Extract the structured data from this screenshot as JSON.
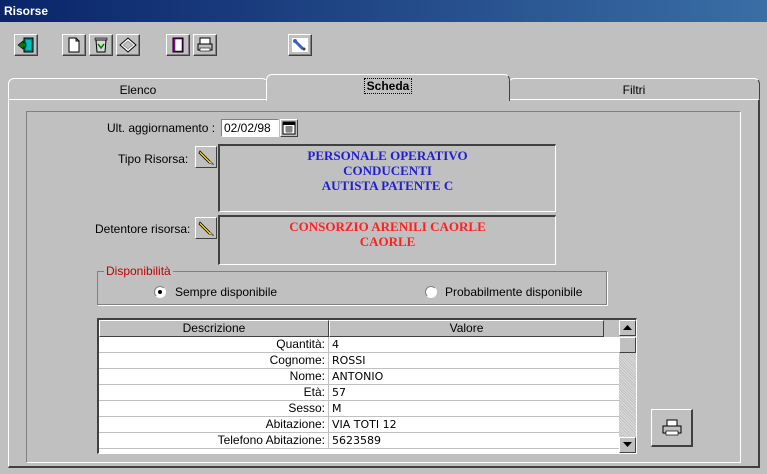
{
  "window": {
    "title": "Risorse"
  },
  "toolbar": {
    "buttons": [
      {
        "icon": "exit-door-icon"
      },
      {
        "icon": "new-document-icon"
      },
      {
        "icon": "recycle-bin-icon"
      },
      {
        "icon": "eraser-icon"
      },
      {
        "icon": "book-icon"
      },
      {
        "icon": "printer-icon"
      },
      {
        "icon": "tools-icon"
      }
    ]
  },
  "tabs": [
    {
      "label": "Elenco",
      "active": false
    },
    {
      "label": "Scheda",
      "active": true
    },
    {
      "label": "Filtri",
      "active": false
    }
  ],
  "form": {
    "last_update_label": "Ult. aggiornamento :",
    "last_update_value": "02/02/98",
    "tipo_label": "Tipo Risorsa:",
    "tipo_lines": [
      "PERSONALE OPERATIVO",
      "CONDUCENTI",
      "AUTISTA PATENTE C"
    ],
    "tipo_color": "#1f1fd0",
    "detentore_label": "Detentore risorsa:",
    "detentore_lines": [
      "CONSORZIO ARENILI CAORLE",
      "CAORLE"
    ],
    "detentore_color": "#ff2020"
  },
  "availability": {
    "legend": "Disponibilità",
    "legend_color": "#c00000",
    "option_1": "Sempre disponibile",
    "option_2": "Probabilmente disponibile",
    "selected": "option_1"
  },
  "grid": {
    "headers": [
      "Descrizione",
      "Valore"
    ],
    "rows": [
      {
        "desc": "Quantità:",
        "value": "4"
      },
      {
        "desc": "Cognome:",
        "value": "ROSSI"
      },
      {
        "desc": "Nome:",
        "value": "ANTONIO"
      },
      {
        "desc": "Età:",
        "value": "57"
      },
      {
        "desc": "Sesso:",
        "value": "M"
      },
      {
        "desc": "Abitazione:",
        "value": "VIA TOTI 12"
      },
      {
        "desc": "Telefono Abitazione:",
        "value": "5623589"
      }
    ]
  }
}
